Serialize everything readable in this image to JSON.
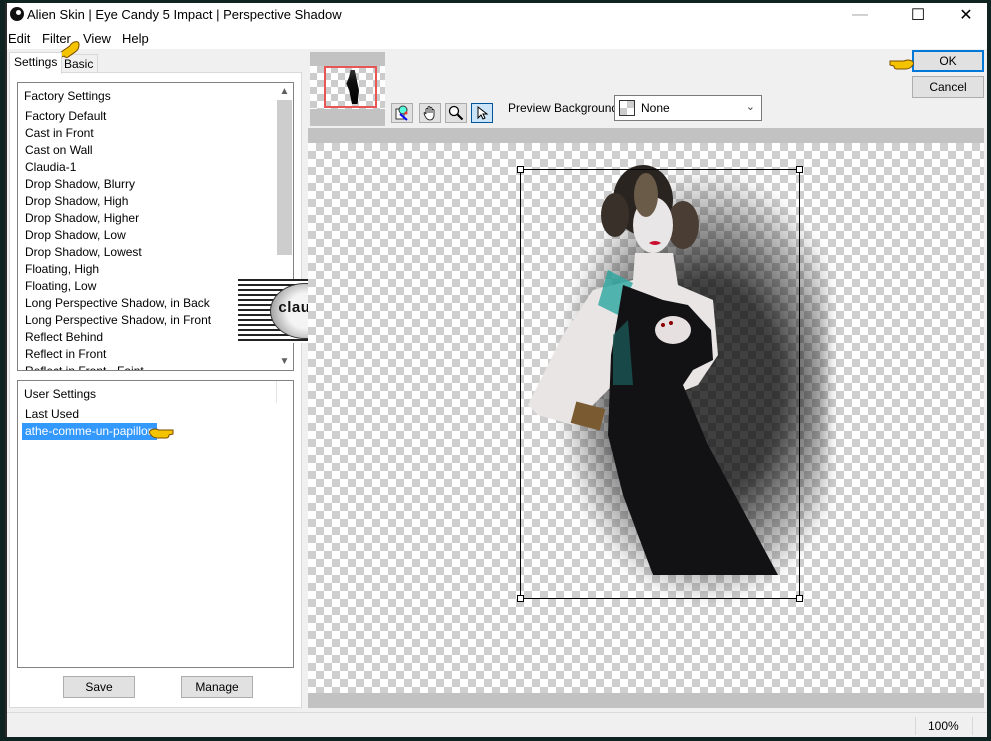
{
  "window": {
    "title": "Alien Skin | Eye Candy 5 Impact | Perspective Shadow",
    "minimize_glyph": "—",
    "maximize_glyph": "☐",
    "close_glyph": "✕"
  },
  "menu": {
    "items": [
      "Edit",
      "Filter",
      "View",
      "Help"
    ]
  },
  "tabs": [
    {
      "label": "Settings",
      "active": true
    },
    {
      "label": "Basic",
      "active": false
    }
  ],
  "factory_settings": {
    "header": "Factory Settings",
    "items": [
      "Factory Default",
      "Cast in Front",
      "Cast on Wall",
      "Claudia-1",
      "Drop Shadow, Blurry",
      "Drop Shadow, High",
      "Drop Shadow, Higher",
      "Drop Shadow, Low",
      "Drop Shadow, Lowest",
      "Floating, High",
      "Floating, Low",
      "Long Perspective Shadow, in Back",
      "Long Perspective Shadow, in Front",
      "Reflect Behind",
      "Reflect in Front",
      "Reflect in Front - Faint"
    ]
  },
  "user_settings": {
    "header": "User Settings",
    "items": [
      {
        "label": "Last Used",
        "selected": false
      },
      {
        "label": "athe-comme-un-papillon",
        "selected": true
      }
    ]
  },
  "buttons": {
    "save": "Save",
    "manage": "Manage",
    "ok": "OK",
    "cancel": "Cancel"
  },
  "toolbar": {
    "tools": [
      {
        "name": "preview-compare",
        "glyph": "⧉",
        "active": false
      },
      {
        "name": "hand-tool",
        "glyph": "✋",
        "active": false
      },
      {
        "name": "zoom-tool",
        "glyph": "🔍",
        "active": false
      },
      {
        "name": "pointer-tool",
        "glyph": "↖",
        "active": true
      }
    ],
    "preview_background_label": "Preview Background:",
    "preview_background_value": "None",
    "chevron_glyph": "⌄"
  },
  "watermark": {
    "text": "claudia"
  },
  "status": {
    "zoom": "100%"
  },
  "colors": {
    "selection": "#3399ff",
    "ok_border": "#0078d7",
    "thumbnail_frame": "#e85555"
  }
}
